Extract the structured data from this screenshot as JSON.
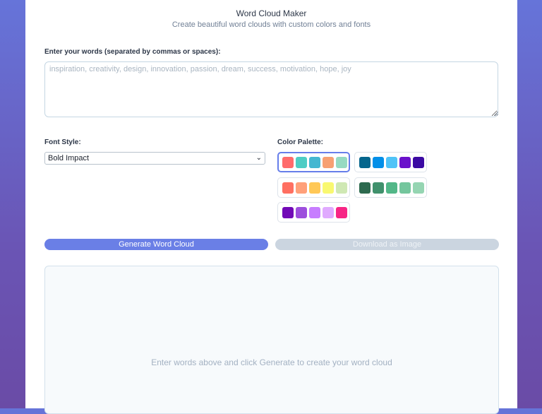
{
  "app": {
    "title": "Word Cloud Maker",
    "subtitle": "Create beautiful word clouds with custom colors and fonts"
  },
  "words": {
    "label": "Enter your words (separated by commas or spaces):",
    "value": "",
    "placeholder": "inspiration, creativity, design, innovation, passion, dream, success, motivation, hope, joy"
  },
  "font": {
    "label": "Font Style:",
    "selected": "Bold Impact"
  },
  "palette": {
    "label": "Color Palette:",
    "options": [
      {
        "colors": [
          "#ff6b6b",
          "#4ecdc4",
          "#45b7d1",
          "#f7a072",
          "#96dac2"
        ],
        "selected": true
      },
      {
        "colors": [
          "#05668d",
          "#028fe8",
          "#4fc3f7",
          "#6a11cb",
          "#3b0aa3"
        ],
        "selected": false
      },
      {
        "colors": [
          "#ff6f61",
          "#ffa07a",
          "#ffc857",
          "#f9f871",
          "#cfe8b4"
        ],
        "selected": false
      },
      {
        "colors": [
          "#2d6a4f",
          "#40916c",
          "#52b788",
          "#74c69d",
          "#95d5b2"
        ],
        "selected": false
      },
      {
        "colors": [
          "#7209b7",
          "#9d4edd",
          "#c77dff",
          "#e0aaff",
          "#f72585"
        ],
        "selected": false
      }
    ]
  },
  "actions": {
    "generate_label": "Generate Word Cloud",
    "download_label": "Download as Image"
  },
  "output": {
    "empty_message": "Enter words above and click Generate to create your word cloud"
  },
  "colors": {
    "accent": "#667eea",
    "background_gradient": [
      "#6674d9",
      "#6a4ba6"
    ]
  }
}
